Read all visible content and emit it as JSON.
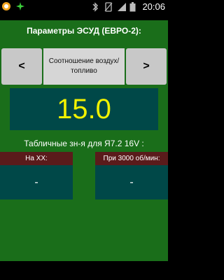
{
  "status_bar": {
    "time": "20:06",
    "icons": [
      "android-notification-icon",
      "settings-notification-icon",
      "bluetooth-icon",
      "no-sim-icon",
      "signal-icon",
      "battery-icon"
    ]
  },
  "panel": {
    "title": "Параметры ЭСУД (ЕВРО-2):",
    "prev_label": "<",
    "next_label": ">",
    "parameter_name": "Соотношение воздух/ топливо",
    "value": "15.0",
    "table_title": "Табличные зн-я для Я7.2 16V :",
    "cards": [
      {
        "label": "На ХХ:",
        "value": "-"
      },
      {
        "label": "При 3000 об/мин:",
        "value": "-"
      }
    ]
  },
  "colors": {
    "panel_bg": "#1a6e1a",
    "value_bg": "#004848",
    "value_text": "#f2f200",
    "card_head_bg": "#5a1b1b",
    "button_bg": "#c8c8c8"
  }
}
